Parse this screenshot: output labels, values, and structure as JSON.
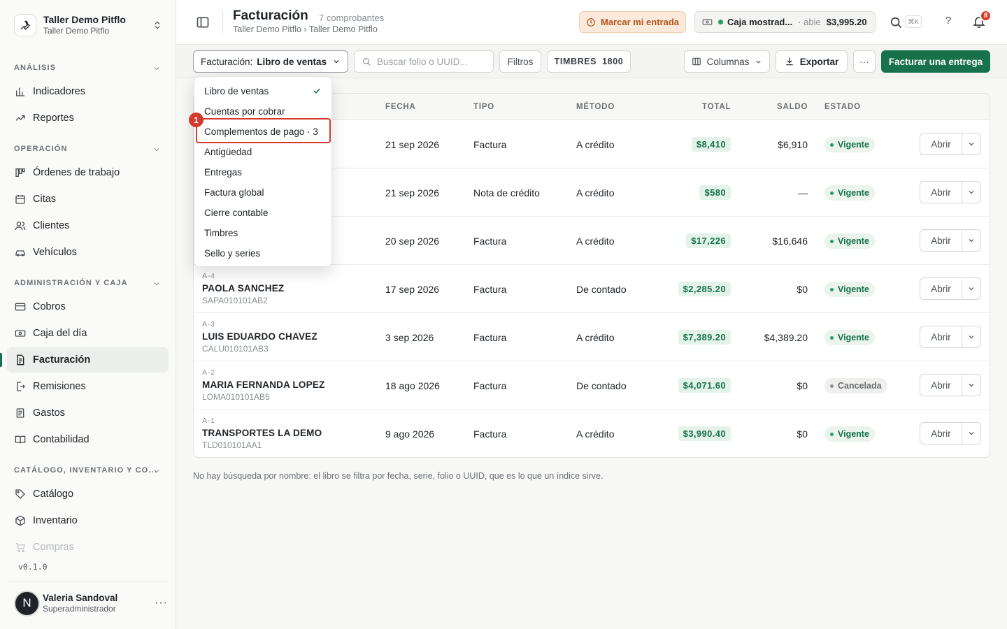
{
  "sidebar": {
    "org_name": "Taller Demo Pitflo",
    "org_sub": "Taller Demo Pitflo",
    "sections": [
      {
        "label": "ANÁLISIS"
      },
      {
        "label": "OPERACIÓN"
      },
      {
        "label": "ADMINISTRACIÓN Y CAJA"
      },
      {
        "label": "CATÁLOGO, INVENTARIO Y CO..."
      }
    ],
    "items": [
      {
        "label": "Indicadores",
        "icon": "chart-bars-icon"
      },
      {
        "label": "Reportes",
        "icon": "trend-icon"
      },
      {
        "label": "Órdenes de trabajo",
        "icon": "kanban-icon"
      },
      {
        "label": "Citas",
        "icon": "calendar-icon"
      },
      {
        "label": "Clientes",
        "icon": "users-icon"
      },
      {
        "label": "Vehículos",
        "icon": "car-icon"
      },
      {
        "label": "Cobros",
        "icon": "credit-card-icon"
      },
      {
        "label": "Caja del día",
        "icon": "cash-icon"
      },
      {
        "label": "Facturación",
        "icon": "receipt-icon"
      },
      {
        "label": "Remisiones",
        "icon": "file-export-icon"
      },
      {
        "label": "Gastos",
        "icon": "receipt-list-icon"
      },
      {
        "label": "Contabilidad",
        "icon": "book-icon"
      },
      {
        "label": "Catálogo",
        "icon": "tag-icon"
      },
      {
        "label": "Inventario",
        "icon": "box-icon"
      },
      {
        "label": "Compras",
        "icon": "cart-icon"
      }
    ],
    "version": "v0.1.0",
    "user": {
      "initial": "N",
      "name": "Valeria Sandoval",
      "role": "Superadministrador"
    }
  },
  "header": {
    "title": "Facturación",
    "count": "7 comprobantes",
    "breadcrumb": "Taller Demo Pitflo › Taller Demo Pitflo",
    "punch_label": "Marcar mi entrada",
    "cash": {
      "name": "Caja mostrad...",
      "status": "· abie",
      "amount": "$3,995.20"
    },
    "shortcut": "⌘K",
    "help": "?",
    "notifications": "8"
  },
  "toolbar": {
    "view_label": "Facturación:",
    "view_value": "Libro de ventas",
    "search_placeholder": "Buscar folio o UUID...",
    "filters": "Filtros",
    "stamps_label": "TIMBRES",
    "stamps_value": "1800",
    "columns": "Columnas",
    "export": "Exportar",
    "primary": "Facturar una entrega"
  },
  "dropdown": {
    "items": [
      "Libro de ventas",
      "Cuentas por cobrar",
      "Complementos de pago · 3",
      "Antigüedad",
      "Entregas",
      "Factura global",
      "Cierre contable",
      "Timbres",
      "Sello y series"
    ],
    "selected": "Libro de ventas",
    "marker": "1"
  },
  "table": {
    "columns": [
      "FECHA",
      "TIPO",
      "MÉTODO",
      "TOTAL",
      "SALDO",
      "ESTADO"
    ],
    "open_label": "Abrir",
    "rows": [
      {
        "folio": "",
        "name": "",
        "rfc": "",
        "date": "21 sep 2026",
        "type": "Factura",
        "method": "A crédito",
        "total": "$8,410",
        "balance": "$6,910",
        "status": "Vigente"
      },
      {
        "folio": "",
        "name": "",
        "rfc": "",
        "date": "21 sep 2026",
        "type": "Nota de crédito",
        "method": "A crédito",
        "total": "$580",
        "balance": "—",
        "status": "Vigente"
      },
      {
        "folio": "",
        "name": "",
        "rfc": "",
        "date": "20 sep 2026",
        "type": "Factura",
        "method": "A crédito",
        "total": "$17,226",
        "balance": "$16,646",
        "status": "Vigente"
      },
      {
        "folio": "A-4",
        "name": "PAOLA SANCHEZ",
        "rfc": "SAPA010101AB2",
        "date": "17 sep 2026",
        "type": "Factura",
        "method": "De contado",
        "total": "$2,285.20",
        "balance": "$0",
        "status": "Vigente"
      },
      {
        "folio": "A-3",
        "name": "LUIS EDUARDO CHAVEZ",
        "rfc": "CALU010101AB3",
        "date": "3 sep 2026",
        "type": "Factura",
        "method": "A crédito",
        "total": "$7,389.20",
        "balance": "$4,389.20",
        "status": "Vigente"
      },
      {
        "folio": "A-2",
        "name": "MARIA FERNANDA LOPEZ",
        "rfc": "LOMA010101AB5",
        "date": "18 ago 2026",
        "type": "Factura",
        "method": "De contado",
        "total": "$4,071.60",
        "balance": "$0",
        "status": "Cancelada"
      },
      {
        "folio": "A-1",
        "name": "TRANSPORTES LA DEMO",
        "rfc": "TLD010101AA1",
        "date": "9 ago 2026",
        "type": "Factura",
        "method": "A crédito",
        "total": "$3,990.40",
        "balance": "$0",
        "status": "Vigente"
      }
    ]
  },
  "footnote": "No hay búsqueda por nombre: el libro se filtra por fecha, serie, folio o UUID, que es lo que un índice sirve.",
  "colors": {
    "accent": "#17714a",
    "warning_bg": "#fbeadb",
    "warning_text": "#b4531b",
    "danger": "#d23a2d"
  }
}
